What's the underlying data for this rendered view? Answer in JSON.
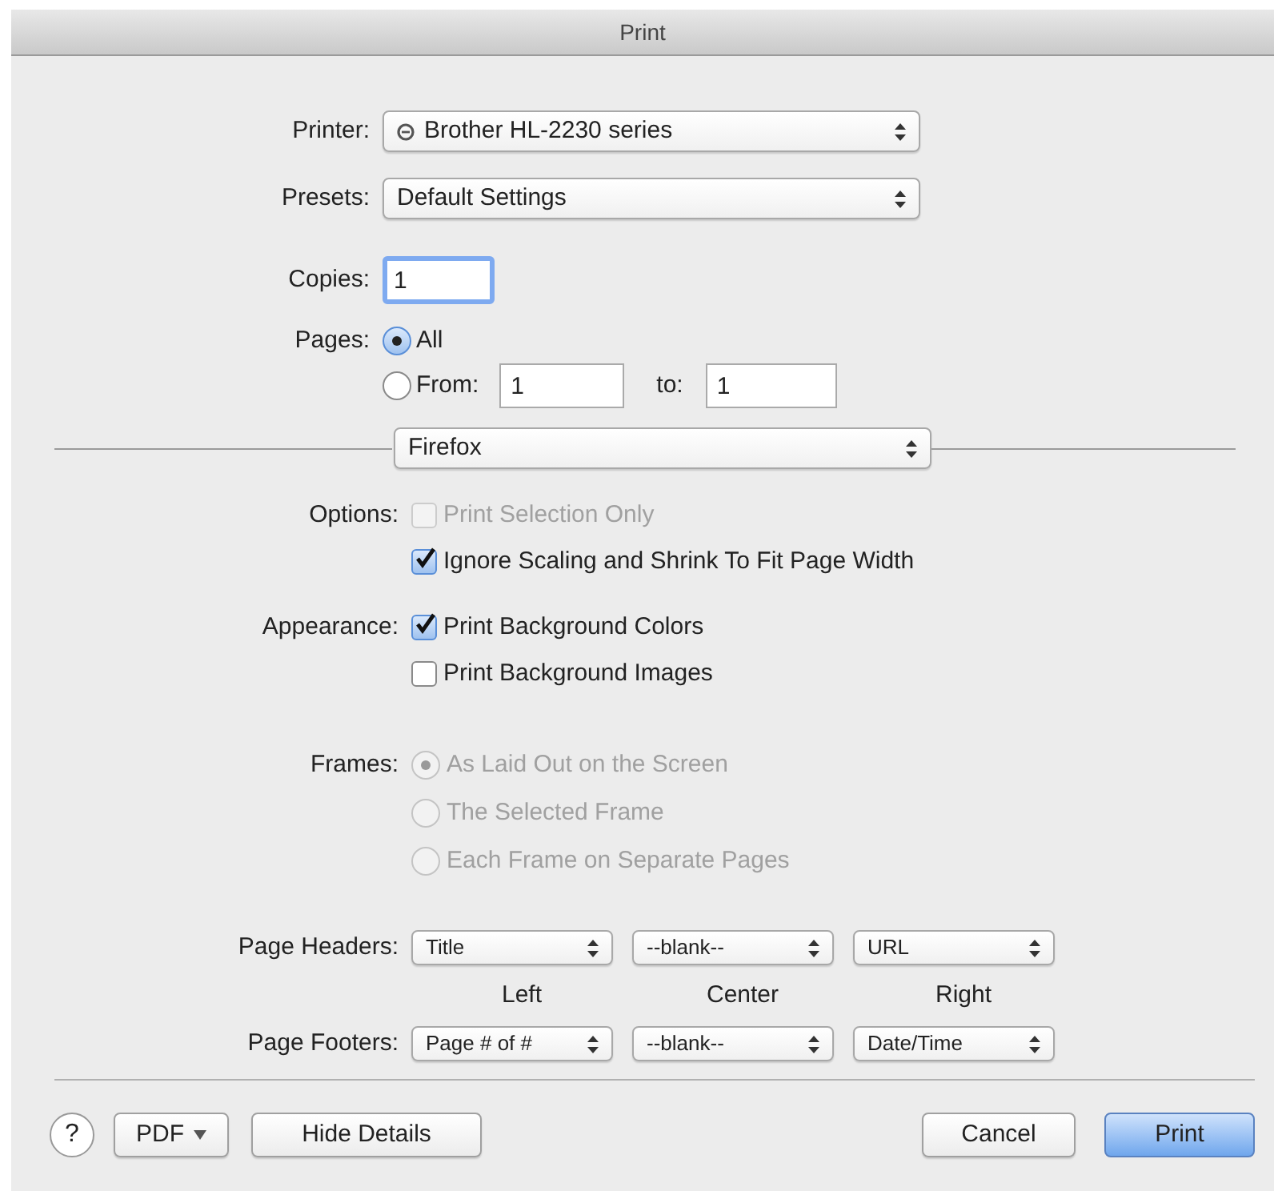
{
  "window": {
    "title": "Print"
  },
  "printer": {
    "label": "Printer:",
    "value": "Brother HL-2230 series"
  },
  "presets": {
    "label": "Presets:",
    "value": "Default Settings"
  },
  "copies": {
    "label": "Copies:",
    "value": "1"
  },
  "pages": {
    "label": "Pages:",
    "options": [
      {
        "kind": "all",
        "label": "All",
        "selected": true
      },
      {
        "kind": "range",
        "label": "From:",
        "selected": false,
        "from": "1",
        "to_label": "to:",
        "to": "1"
      }
    ]
  },
  "section_popup": {
    "value": "Firefox"
  },
  "options": {
    "label": "Options:",
    "items": [
      {
        "label": "Print Selection Only",
        "checked": false,
        "disabled": true
      },
      {
        "label": "Ignore Scaling and Shrink To Fit Page Width",
        "checked": true,
        "disabled": false
      }
    ]
  },
  "appearance": {
    "label": "Appearance:",
    "items": [
      {
        "label": "Print Background Colors",
        "checked": true,
        "disabled": false
      },
      {
        "label": "Print Background Images",
        "checked": false,
        "disabled": false
      }
    ]
  },
  "frames": {
    "label": "Frames:",
    "items": [
      {
        "label": "As Laid Out on the Screen",
        "selected": true,
        "disabled": true
      },
      {
        "label": "The Selected Frame",
        "selected": false,
        "disabled": true
      },
      {
        "label": "Each Frame on Separate Pages",
        "selected": false,
        "disabled": true
      }
    ]
  },
  "page_headers": {
    "label": "Page Headers:",
    "values": [
      "Title",
      "--blank--",
      "URL"
    ]
  },
  "column_labels": [
    "Left",
    "Center",
    "Right"
  ],
  "page_footers": {
    "label": "Page Footers:",
    "values": [
      "Page # of #",
      "--blank--",
      "Date/Time"
    ]
  },
  "buttons": {
    "help": "?",
    "pdf": "PDF",
    "hide_details": "Hide Details",
    "cancel": "Cancel",
    "print": {
      "label": "Print",
      "default": true
    }
  }
}
